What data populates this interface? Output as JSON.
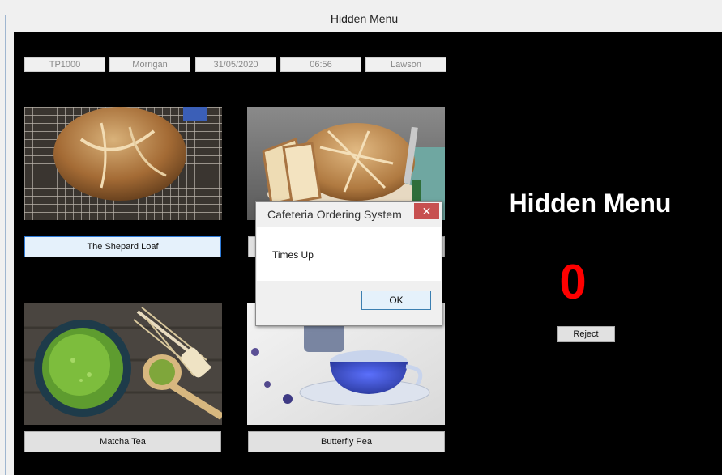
{
  "window": {
    "title": "Hidden Menu"
  },
  "info_fields": [
    "TP1000",
    "Morrigan",
    "31/05/2020",
    "06:56",
    "Lawson"
  ],
  "menu_items": [
    {
      "label": "The Shepard Loaf",
      "image": "bread-photo"
    },
    {
      "label": "",
      "image": "sliced-bread-photo"
    },
    {
      "label": "Matcha Tea",
      "image": "matcha-photo"
    },
    {
      "label": "Butterfly Pea",
      "image": "tea-photo"
    }
  ],
  "panel": {
    "title": "Hidden Menu",
    "counter": "0",
    "reject_label": "Reject",
    "counter_color": "#ff0000"
  },
  "dialog": {
    "title": "Cafeteria Ordering System",
    "message": "Times Up",
    "ok_label": "OK",
    "close_icon": "✕"
  }
}
